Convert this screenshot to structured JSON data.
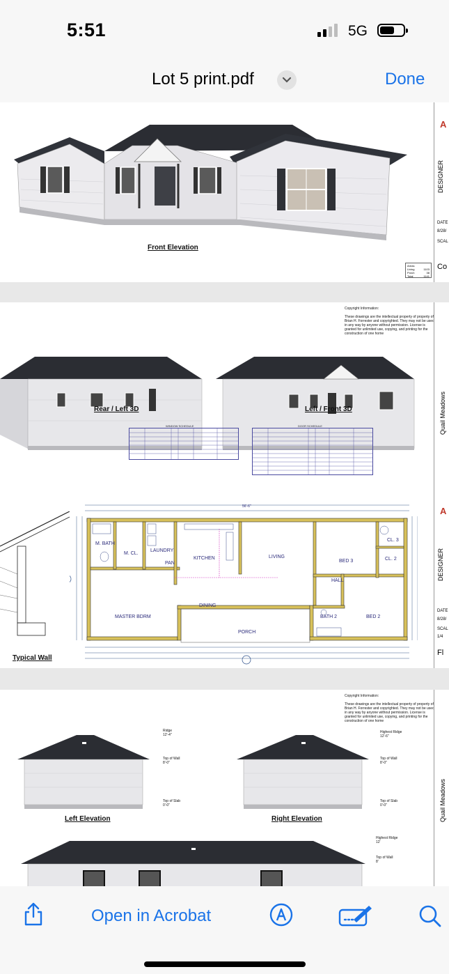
{
  "status": {
    "time": "5:51",
    "network": "5G"
  },
  "nav": {
    "title": "Lot 5 print.pdf",
    "done_label": "Done"
  },
  "page1": {
    "caption": "Front Elevation",
    "title_block": {
      "designer": "DESIGNER",
      "date": "DATE",
      "date_value": "8/28/",
      "scale": "SCAL",
      "bottom": "Co"
    },
    "areas_table": {
      "label": "Areas",
      "rows": [
        "Living",
        "Porch",
        "Total"
      ],
      "values": [
        "1103",
        "38",
        "1141"
      ]
    }
  },
  "page2": {
    "copyright_title": "Copyright Information:",
    "copyright_text": "These drawings are the intellectual property of property of Brian H. Forrester and copyrighted. They may not be used in any way by anyone without permission. License is granted for unlimited use, copying, and printing for the construction of one home",
    "captions": {
      "rear_left": "Rear / Left 3D",
      "left_front": "Left / Front 3D",
      "typical_wall": "Typical Wall"
    },
    "title_block": {
      "project": "Quail Meadows",
      "designer": "DESIGNER",
      "date": "DATE",
      "date_value": "8/28/",
      "scale": "SCAL",
      "scale_value": "1/4",
      "bottom": "Fl"
    },
    "window_schedule_title": "WINDOW SCHEDULE",
    "door_schedule_title": "DOOR SCHEDULE",
    "rooms": {
      "m_bath": "M. BATH",
      "m_cl": "M. CL.",
      "laundry": "LAUNDRY",
      "pan": "PAN",
      "kitchen": "KITCHEN",
      "living": "LIVING",
      "bed3": "BED 3",
      "cl3": "CL. 3",
      "cl2": "CL. 2",
      "hall": "HALL",
      "master": "MASTER BDRM",
      "dining": "DINING",
      "porch": "PORCH",
      "bath2": "BATH 2",
      "bed2": "BED 2"
    },
    "overall_dim": "56'-6\""
  },
  "page3": {
    "copyright_title": "Copyright Information:",
    "copyright_text": "These drawings are the intellectual property of property of Brian H. Forrester and copyrighted. They may not be used in any way by anyone without permission. License is granted for unlimited use, copying, and printing for the construction of one home",
    "captions": {
      "left": "Left Elevation",
      "right": "Right Elevation"
    },
    "markers": {
      "ridge": "Ridge",
      "ridge_val": "12'-4\"",
      "highest_ridge": "Highest Ridge",
      "highest_ridge_val": "12'-6\"",
      "top_wall": "Top of Wall",
      "top_wall_val": "8'-0\"",
      "top_slab": "Top of Slab",
      "top_slab_val": "0'-0\"",
      "highest_ridge_b": "Highest Ridge",
      "highest_ridge_b_val": "12'",
      "top_wall_b": "Top of Wall",
      "top_wall_b_val": "8'"
    },
    "title_block": {
      "project": "Quail Meadows"
    }
  },
  "toolbar": {
    "open_label": "Open in Acrobat"
  },
  "colors": {
    "accent": "#1a73e8",
    "roof": "#2b2d33",
    "siding": "#e9e9ec",
    "wall_fill": "#d8c15a"
  }
}
